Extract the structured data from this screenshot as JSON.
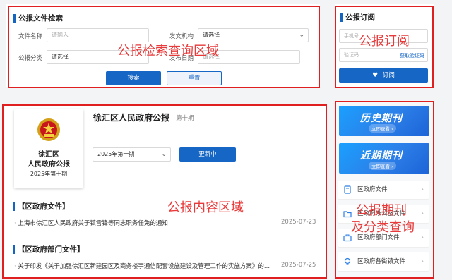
{
  "search": {
    "title": "公报文件检索",
    "file_name_label": "文件名称",
    "file_name_placeholder": "请输入",
    "agency_label": "发文机构",
    "agency_value": "请选择",
    "category_label": "公报分类",
    "category_value": "请选择",
    "date_label": "发布日期",
    "date_placeholder": "请选择",
    "search_button": "搜索",
    "reset_button": "重置"
  },
  "subscribe": {
    "title": "公报订阅",
    "phone_placeholder": "手机号",
    "code_placeholder": "验证码",
    "get_code": "获取验证码",
    "subscribe_button": "订阅"
  },
  "bulletin": {
    "title": "徐汇区人民政府公报",
    "issue": "第十期",
    "cover_line1": "徐汇区",
    "cover_line2": "人民政府公报",
    "cover_issue": "2025年第十期",
    "select_value": "2025年第十期",
    "updating_button": "更新中"
  },
  "sections": [
    {
      "title": "【区政府文件】",
      "items": [
        {
          "text": "上海市徐汇区人民政府关于镇雪锋等同志职务任免的通知",
          "date": "2025-07-23"
        }
      ]
    },
    {
      "title": "【区政府部门文件】",
      "items": [
        {
          "text": "关于印发《关于加强徐汇区新建园区及商务楼宇通信配套设施建设及管理工作的实施方案》的...",
          "date": "2025-07-25"
        }
      ]
    }
  ],
  "sidebar": {
    "banner_history": "历史期刊",
    "banner_history_sub": "立即查看 ›",
    "banner_recent": "近期期刊",
    "banner_recent_sub": "立即查看 ›",
    "categories": [
      {
        "label": "区政府文件",
        "icon": "document-icon"
      },
      {
        "label": "区政府办公室文件",
        "icon": "folder-icon"
      },
      {
        "label": "区政府部门文件",
        "icon": "briefcase-icon"
      },
      {
        "label": "区政府各街镇文件",
        "icon": "lightbulb-icon"
      }
    ]
  },
  "annotations": {
    "search_area": "公报检索查询区域",
    "subscribe_area": "公报订阅",
    "content_area": "公报内容区域",
    "periodical_area_line1": "公报期刊",
    "periodical_area_line2": "及分类查询"
  },
  "colors": {
    "primary": "#1666c5",
    "annotation": "#e02020"
  }
}
